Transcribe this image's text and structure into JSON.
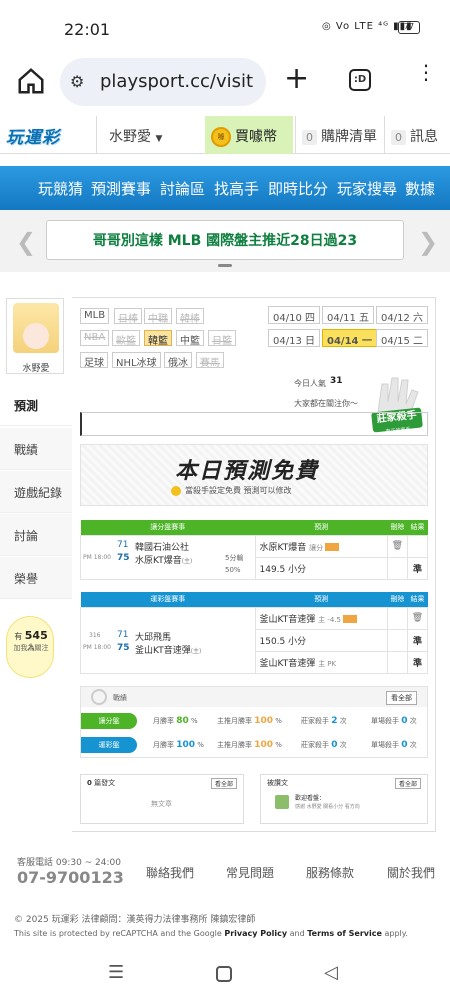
{
  "status": {
    "time": "22:01",
    "icons": "◎ Vo LTE ⁴ᴳ ▮▮▮",
    "battery": "77"
  },
  "browser": {
    "url": "playsport.cc/visit",
    "tab_count": ":D"
  },
  "topbar": {
    "logo": "玩運彩",
    "user": "水野愛",
    "buy_coin": "買噱幣",
    "coin_label": "噱",
    "cart_count": "0",
    "cart": "購牌清單",
    "msg_count": "0",
    "msg": "訊息"
  },
  "nav": [
    "玩競猜",
    "預測賽事",
    "討論區",
    "找高手",
    "即時比分",
    "玩家搜尋",
    "數據"
  ],
  "banner": {
    "text": "哥哥別這樣 MLB 國際盤主推近28日過23"
  },
  "sidebar": {
    "username": "水野愛",
    "tabs": [
      "預測",
      "戰績",
      "遊戲紀錄",
      "討論",
      "榮譽"
    ],
    "bulb_prefix": "有",
    "bulb_count": "545",
    "bulb_suffix": "人",
    "bulb_note": "加我為關注"
  },
  "sports": {
    "row1": [
      "MLB",
      "日棒",
      "中職",
      "韓棒"
    ],
    "row2": [
      "NBA",
      "歐籃",
      "韓籃",
      "中籃",
      "日籃"
    ],
    "row3": [
      "足球",
      "NHL冰球",
      "俄冰",
      "賽馬"
    ]
  },
  "dates": {
    "row1": [
      "04/10 四",
      "04/11 五",
      "04/12 六"
    ],
    "row2": [
      "04/13 日",
      "04/14 一",
      "04/15 二"
    ]
  },
  "popularity": {
    "label": "今日人氣",
    "value": "31",
    "follow": "大家都在關注你～"
  },
  "hand_tag": "莊家殺手",
  "hand_sub": "真正的高手",
  "free": {
    "title": "本日預測免費",
    "sub": "當殺手設定免費 預測可以修改"
  },
  "match1": {
    "headers": [
      "讓分盤賽事",
      "預測",
      "刪除",
      "結果"
    ],
    "time": "PM 18:00",
    "away_no": "71",
    "away": "韓國石油公社",
    "home_no": "75",
    "home": "水原KT爆音",
    "home_tag": "(主)",
    "extra1": "5分輸",
    "extra2": "50%",
    "pred1": "水原KT爆音",
    "pred1_note": "讓分",
    "pred2": "149.5 小分",
    "result": "準"
  },
  "match2": {
    "headers": [
      "運彩盤賽事",
      "預測",
      "刪除",
      "結果"
    ],
    "id": "316",
    "time": "PM 18:00",
    "away_no": "71",
    "away": "大邱飛馬",
    "home_no": "75",
    "home": "釜山KT音速彈",
    "home_tag": "(主)",
    "pred1": "釜山KT音速彈",
    "pred1_note": "主 -4.5",
    "pred2": "150.5 小分",
    "pred3": "釜山KT音速彈",
    "pred3_note": "主 PK",
    "results": [
      "準",
      "準",
      "準"
    ]
  },
  "record": {
    "title": "戰績",
    "view_all": "看全部",
    "rows": [
      {
        "label": "讓分盤",
        "c1": "月勝率",
        "v1": "80",
        "u1": "%",
        "c2": "主推月勝率",
        "v2": "100",
        "u2": "%",
        "c3": "莊家殺手",
        "v3": "2",
        "u3": "次",
        "c4": "單場殺手",
        "v4": "0",
        "u4": "次"
      },
      {
        "label": "運彩盤",
        "c1": "月勝率",
        "v1": "100",
        "u1": "%",
        "c2": "主推月勝率",
        "v2": "100",
        "u2": "%",
        "c3": "莊家殺手",
        "v3": "0",
        "u3": "次",
        "c4": "單場殺手",
        "v4": "0",
        "u4": "次"
      }
    ]
  },
  "posts": {
    "count": "0",
    "label": "篇發文",
    "view_all": "看全部",
    "empty": "無文章"
  },
  "replies": {
    "label": "被讚文",
    "view_all": "看全部",
    "user": "歡迎看盤：",
    "text": "感謝 水野愛 關看小分 看方向"
  },
  "footer": {
    "phone_label": "客服電話 09:30 ~ 24:00",
    "phone": "07-9700123",
    "links": [
      "聯絡我們",
      "常見問題",
      "服務條款",
      "關於我們"
    ],
    "copyright": "© 2025 玩運彩  法律顧問：漢英得力法律事務所 陳鎮宏律師",
    "recaptcha_pre": "This site is protected by reCAPTCHA and the Google",
    "privacy": "Privacy Policy",
    "and": "and",
    "terms": "Terms of Service",
    "apply": "apply."
  },
  "colors": {
    "brand_blue": "#1378c2",
    "green": "#4cb426",
    "accent_yellow": "#fbe15b"
  }
}
